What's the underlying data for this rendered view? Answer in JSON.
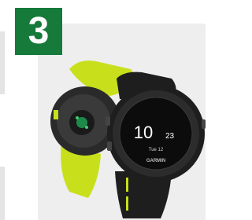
{
  "badge": {
    "number": "3",
    "color": "#157a3a"
  },
  "watch": {
    "time": "10:23",
    "hour": "10",
    "minute": "23",
    "date": "Tue 12",
    "brand": "GARMIN"
  },
  "colors": {
    "band_yellow": "#c8e01c",
    "watch_black": "#1e1e1e",
    "panel_bg": "#eeeeee"
  },
  "icons": [
    "heart-rate-sensor-icon"
  ]
}
